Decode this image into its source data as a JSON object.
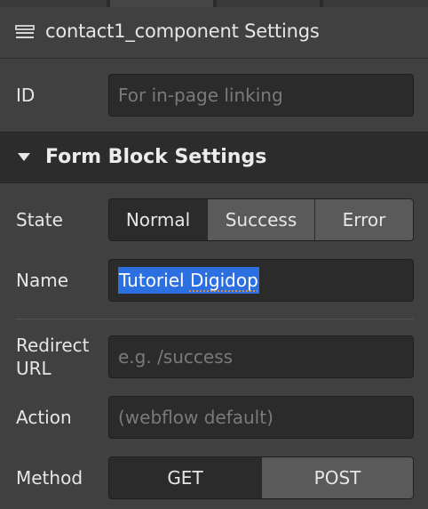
{
  "header": {
    "title": "contact1_component Settings",
    "icon": "component-icon"
  },
  "id_field": {
    "label": "ID",
    "placeholder": "For in-page linking"
  },
  "section": {
    "title": "Form Block Settings",
    "icon": "caret-down-icon"
  },
  "state": {
    "label": "State",
    "options": [
      "Normal",
      "Success",
      "Error"
    ],
    "selected": "Normal"
  },
  "name_field": {
    "label": "Name",
    "value_word1": "Tutoriel",
    "value_word2": "Digidop"
  },
  "redirect": {
    "label_line1": "Redirect",
    "label_line2": "URL",
    "placeholder": "e.g. /success"
  },
  "action": {
    "label": "Action",
    "placeholder": "(webflow default)"
  },
  "method": {
    "label": "Method",
    "options": [
      "GET",
      "POST"
    ],
    "selected": "GET"
  },
  "colors": {
    "panel_bg": "#404040",
    "input_bg": "#2b2b2b",
    "section_bg": "#2c2c2c",
    "selection_highlight": "#2c6fe0",
    "unselected_segment": "#5a5a5a"
  }
}
